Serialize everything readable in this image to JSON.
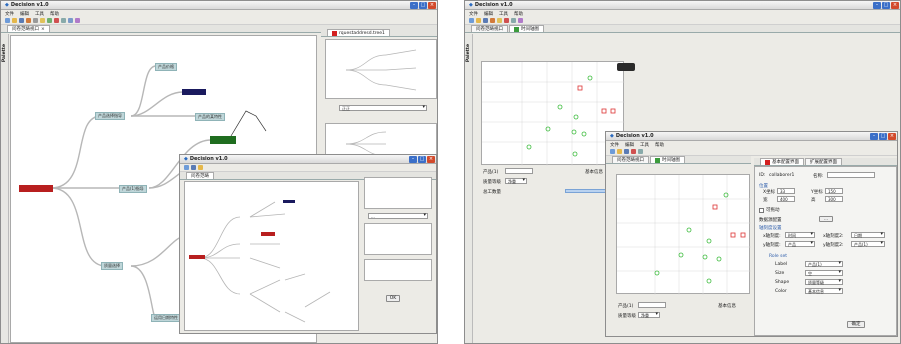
{
  "app": {
    "title": "Decision v1.0",
    "menu": [
      "文件",
      "编辑",
      "工具",
      "帮助"
    ],
    "palette_label": "Palette"
  },
  "left": {
    "tab_main": "问卷范畴视口",
    "tab_file": "rquestaddresd.tree1",
    "sidebar_select": "正正",
    "nodes": {
      "root": "",
      "mid1": "产品选择指导",
      "mid2": "产品(1)指导",
      "mid3": "质量选择",
      "leaf1": "产品价格",
      "leaf2": "",
      "leaf3": "产品的某特性",
      "leaf4": "",
      "leaf5": "运用日期特性"
    },
    "inner": {
      "title": "Decision v1.0",
      "tab": "问卷范畴",
      "select": "...",
      "button": "OK"
    }
  },
  "right": {
    "tab_main": "问卷范畴视口",
    "tab_chart": "时间轴图",
    "lower_labels": {
      "product": "产品(1)",
      "quality": "质量等级",
      "quality_val": "净重",
      "sales": "总工数量",
      "basic": "基本信息"
    },
    "dialog": {
      "title": "Decision v1.0",
      "menu": [
        "文件",
        "编辑",
        "工具",
        "帮助"
      ],
      "tab_main": "问卷范畴视口",
      "tab_chart": "时间轴图",
      "prop_tab1": "基本配置界面",
      "prop_tab2": "扩展配置界面",
      "id_label": "ID:",
      "id_value": "collaborer1",
      "name_label": "名称:",
      "name_value": "",
      "position_title": "位置",
      "x_label": "X坐标",
      "x_value": "33",
      "y_label": "Y坐标",
      "y_value": "150",
      "w_label": "宽",
      "w_value": "400",
      "h_label": "高",
      "h_value": "300",
      "checkbox_label": "可拖动",
      "data_label": "数据源配置",
      "data_button": "...",
      "axis_title": "轴刻度设置",
      "x_axis_label": "x轴刻度:",
      "x_axis_value": "时间",
      "x_axis_label2": "x轴刻度2:",
      "x_axis_value2": "日期",
      "y_axis_label": "y轴刻度:",
      "y_axis_value": "产品",
      "y_axis_label2": "y轴刻度2:",
      "y_axis_value2": "产品(1)",
      "role_title": "Role set",
      "role_rows": [
        {
          "label": "Label",
          "value": "产品(1)"
        },
        {
          "label": "Size",
          "value": "空"
        },
        {
          "label": "Shape",
          "value": "质量等级"
        },
        {
          "label": "Color",
          "value": "基本信息"
        }
      ],
      "ok_button": "确定",
      "lower_product": "产品(1)",
      "lower_quality": "质量等级",
      "lower_quality_val": "净重",
      "lower_basic": "基本信息"
    }
  },
  "colors": {
    "accent": "#2c6bbf",
    "red": "#b81f1f",
    "navy": "#1a1a5e",
    "green_dark": "#1f6d1f",
    "node_bg": "#bfd6d9"
  }
}
